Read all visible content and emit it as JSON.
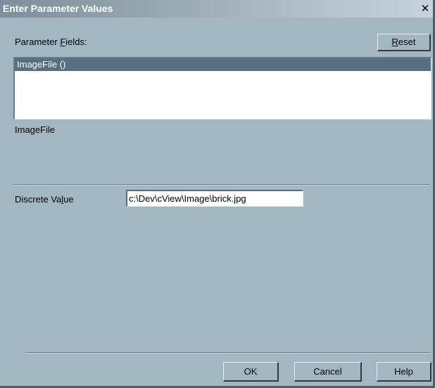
{
  "window": {
    "title": "Enter Parameter Values",
    "close_glyph": "✕"
  },
  "parameter_fields": {
    "label_pre": "Parameter ",
    "label_mn": "F",
    "label_post": "ields:",
    "items": [
      {
        "label": "ImageFile ()"
      }
    ]
  },
  "reset_button": {
    "mn": "R",
    "rest": "eset"
  },
  "selected_field_name": "ImageFile",
  "discrete_value": {
    "label_pre": "Discrete Va",
    "label_mn": "l",
    "label_post": "ue",
    "value": "c:\\Dev\\cView\\Image\\brick.jpg"
  },
  "footer": {
    "ok_label": "OK",
    "cancel_label": "Cancel",
    "help_label": "Help"
  },
  "colors": {
    "dialog_bg": "#a3b7c3",
    "selection": "#56707f"
  },
  "icons": {
    "close": "close-icon"
  }
}
